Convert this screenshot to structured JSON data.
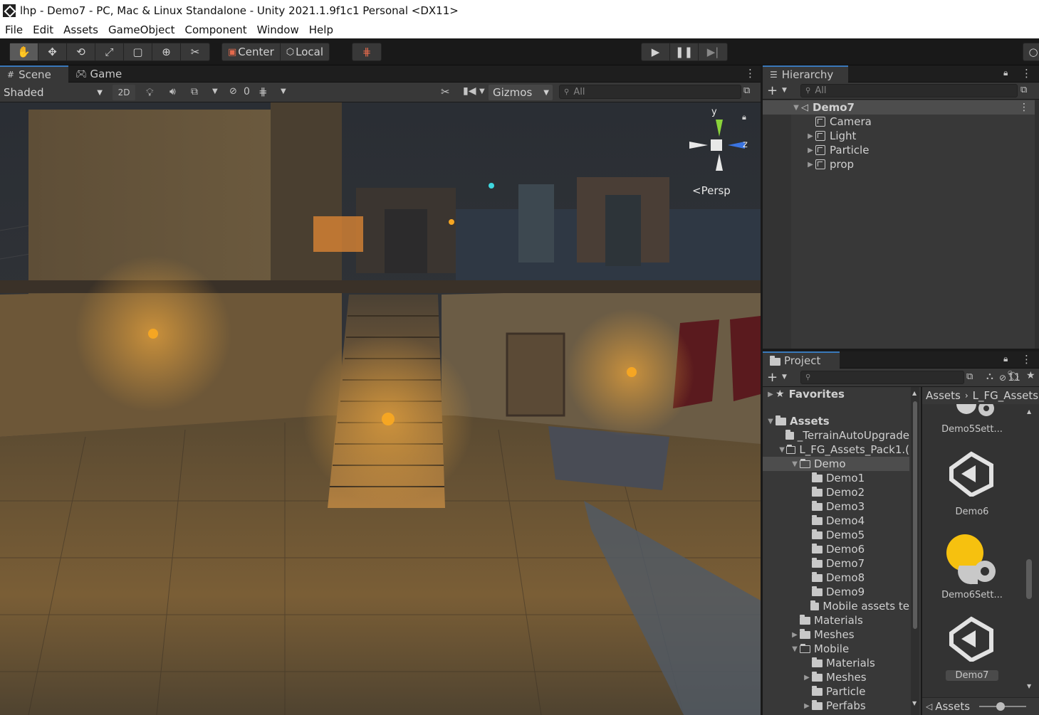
{
  "window": {
    "title": "lhp - Demo7 - PC, Mac & Linux Standalone - Unity 2021.1.9f1c1 Personal <DX11>"
  },
  "menu": [
    "File",
    "Edit",
    "Assets",
    "GameObject",
    "Component",
    "Window",
    "Help"
  ],
  "toolbar": {
    "tools": [
      "hand-icon",
      "move-icon",
      "rotate-icon",
      "scale-icon",
      "rect-icon",
      "transform-icon",
      "custom-tool-icon"
    ],
    "pivot": "Center",
    "space": "Local",
    "play_controls": [
      "play-icon",
      "pause-icon",
      "step-icon"
    ]
  },
  "scene": {
    "tabs": [
      "Scene",
      "Game"
    ],
    "shading": "Shaded",
    "mode_2d": "2D",
    "hidden_count": "0",
    "gizmos": "Gizmos",
    "search_placeholder": "All",
    "axis_y": "y",
    "axis_z": "z",
    "projection": "Persp"
  },
  "hierarchy": {
    "title": "Hierarchy",
    "search_placeholder": "All",
    "scene_name": "Demo7",
    "objects": [
      {
        "name": "Camera",
        "expandable": false
      },
      {
        "name": "Light",
        "expandable": true
      },
      {
        "name": "Particle",
        "expandable": true
      },
      {
        "name": "prop",
        "expandable": true
      }
    ]
  },
  "project": {
    "title": "Project",
    "hidden_count": "11",
    "favorites": "Favorites",
    "tree": [
      {
        "label": "Assets",
        "depth": 0,
        "arrow": "down",
        "bold": true
      },
      {
        "label": "_TerrainAutoUpgrade",
        "depth": 1,
        "arrow": "none"
      },
      {
        "label": "L_FG_Assets_Pack1.(",
        "depth": 1,
        "arrow": "down",
        "open": true
      },
      {
        "label": "Demo",
        "depth": 2,
        "arrow": "down",
        "open": true,
        "selected": true
      },
      {
        "label": "Demo1",
        "depth": 3,
        "arrow": "none"
      },
      {
        "label": "Demo2",
        "depth": 3,
        "arrow": "none"
      },
      {
        "label": "Demo3",
        "depth": 3,
        "arrow": "none"
      },
      {
        "label": "Demo4",
        "depth": 3,
        "arrow": "none"
      },
      {
        "label": "Demo5",
        "depth": 3,
        "arrow": "none"
      },
      {
        "label": "Demo6",
        "depth": 3,
        "arrow": "none"
      },
      {
        "label": "Demo7",
        "depth": 3,
        "arrow": "none"
      },
      {
        "label": "Demo8",
        "depth": 3,
        "arrow": "none"
      },
      {
        "label": "Demo9",
        "depth": 3,
        "arrow": "none"
      },
      {
        "label": "Mobile assets te",
        "depth": 3,
        "arrow": "none"
      },
      {
        "label": "Materials",
        "depth": 2,
        "arrow": "none"
      },
      {
        "label": "Meshes",
        "depth": 2,
        "arrow": "right"
      },
      {
        "label": "Mobile",
        "depth": 2,
        "arrow": "down",
        "open": true
      },
      {
        "label": "Materials",
        "depth": 3,
        "arrow": "none"
      },
      {
        "label": "Meshes",
        "depth": 3,
        "arrow": "right"
      },
      {
        "label": "Particle",
        "depth": 3,
        "arrow": "none"
      },
      {
        "label": "Perfabs",
        "depth": 3,
        "arrow": "right"
      }
    ],
    "breadcrumb": [
      "Assets",
      "L_FG_Assets"
    ],
    "assets": [
      {
        "name": "Demo5Sett...",
        "kind": "settings-icon"
      },
      {
        "name": "Demo6",
        "kind": "unity-scene-icon"
      },
      {
        "name": "Demo6Sett...",
        "kind": "settings-icon"
      },
      {
        "name": "Demo7",
        "kind": "unity-scene-icon"
      }
    ],
    "footer_path": "Assets"
  }
}
